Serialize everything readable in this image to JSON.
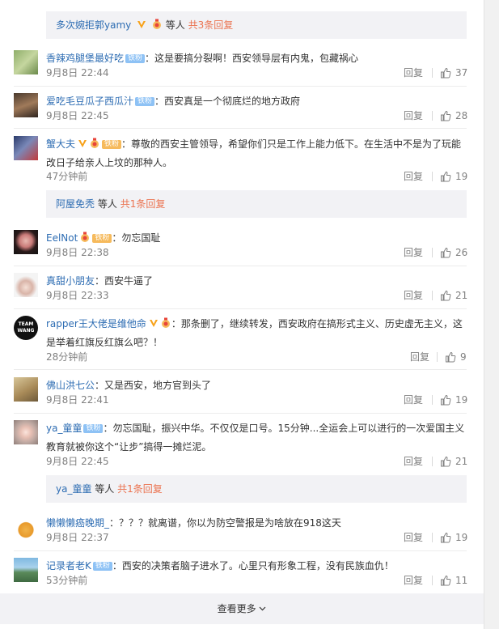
{
  "sub_top": {
    "names": "多次婉拒郭yamy",
    "mid": "等人",
    "link": "共3条回复"
  },
  "comments": [
    {
      "name": "香辣鸡腿堡最好吃",
      "badge": "铁粉",
      "text": "：这是要搞分裂啊！西安领导层有内鬼，包藏祸心",
      "time": "9月8日 22:44",
      "reply": "回复",
      "likes": "37"
    },
    {
      "name": "爱吃毛豆瓜子西瓜汁",
      "badge": "铁粉",
      "text": "：西安真是一个彻底烂的地方政府",
      "time": "9月8日 22:45",
      "reply": "回复",
      "likes": "28"
    },
    {
      "name": "蟹大夫",
      "badge": "铁粉",
      "text": "：尊敬的西安主管领导，希望你们只是工作上能力低下。在生活中不是为了玩能",
      "text2": "改日子给亲人上坟的那种人。",
      "time": "47分钟前",
      "reply": "回复",
      "likes": "19"
    },
    {
      "name": "EelNot",
      "badge": "铁粉",
      "text": "：勿忘国耻",
      "time": "9月8日 22:38",
      "reply": "回复",
      "likes": "26"
    },
    {
      "name": "真甜小朋友",
      "text": "：西安牛逼了",
      "time": "9月8日 22:33",
      "reply": "回复",
      "likes": "21"
    },
    {
      "name": "rapper王大佬是维他命",
      "text": "：那条删了，继续转发，西安政府在搞形式主义、历史虚无主义，这",
      "text2": "是举着红旗反红旗么吧？！",
      "time": "28分钟前",
      "reply": "回复",
      "likes": "9"
    },
    {
      "name": "佛山洪七公",
      "text": "：又是西安，地方官到头了",
      "time": "9月8日 22:41",
      "reply": "回复",
      "likes": "19"
    },
    {
      "name": "ya_童童",
      "badge": "铁粉",
      "text": "：勿忘国耻，振兴中华。不仅仅是口号。15分钟...全运会上可以进行的一次爱国主义",
      "text2": "教育就被你这个“让步”搞得一摊烂泥。",
      "time": "9月8日 22:45",
      "reply": "回复",
      "likes": "21"
    },
    {
      "name": "懒懒懒癌晚期_",
      "text": "：？？？就离谱，你以为防空警报是为啥放在918这天",
      "time": "9月8日 22:37",
      "reply": "回复",
      "likes": "19"
    },
    {
      "name": "记录者老K",
      "badge": "铁粉",
      "text": "：西安的决策者脑子进水了。心里只有形象工程，没有民族血仇！",
      "time": "53分钟前",
      "reply": "回复",
      "likes": "11"
    }
  ],
  "sub_3": {
    "names": "阿屋免秃",
    "mid": "等人",
    "link": "共1条回复"
  },
  "sub_8": {
    "names": "ya_童童",
    "mid": "等人",
    "link": "共1条回复"
  },
  "avatar_team_text": "TEAM WANG",
  "more": "查看更多",
  "colors": {
    "link_blue": "#2e6db3",
    "orange": "#eb7350",
    "meta_gray": "#808080",
    "sub_bg": "#f2f2f5",
    "fan_badge": "#8ec2f5"
  }
}
